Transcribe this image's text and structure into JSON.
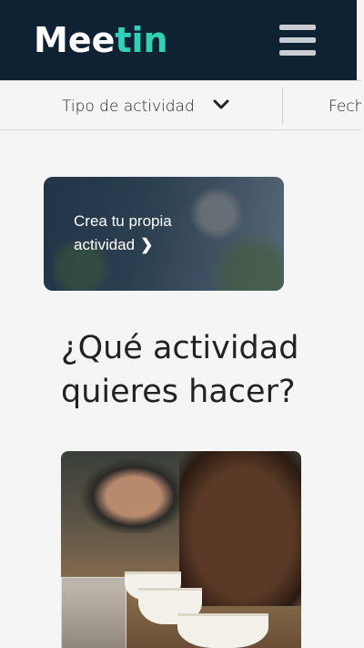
{
  "header": {
    "logo_text_white": "Mee",
    "logo_text_teal": "tin",
    "brand_colors": {
      "navy": "#0f2233",
      "teal": "#2ed3b7"
    }
  },
  "filters": {
    "activity_type_label": "Tipo de actividad",
    "date_label": "Fech"
  },
  "create_card": {
    "label_line1": "Crea tu propia",
    "label_line2": "actividad",
    "arrow": "❯"
  },
  "main": {
    "heading": "¿Qué actividad quieres hacer?"
  }
}
